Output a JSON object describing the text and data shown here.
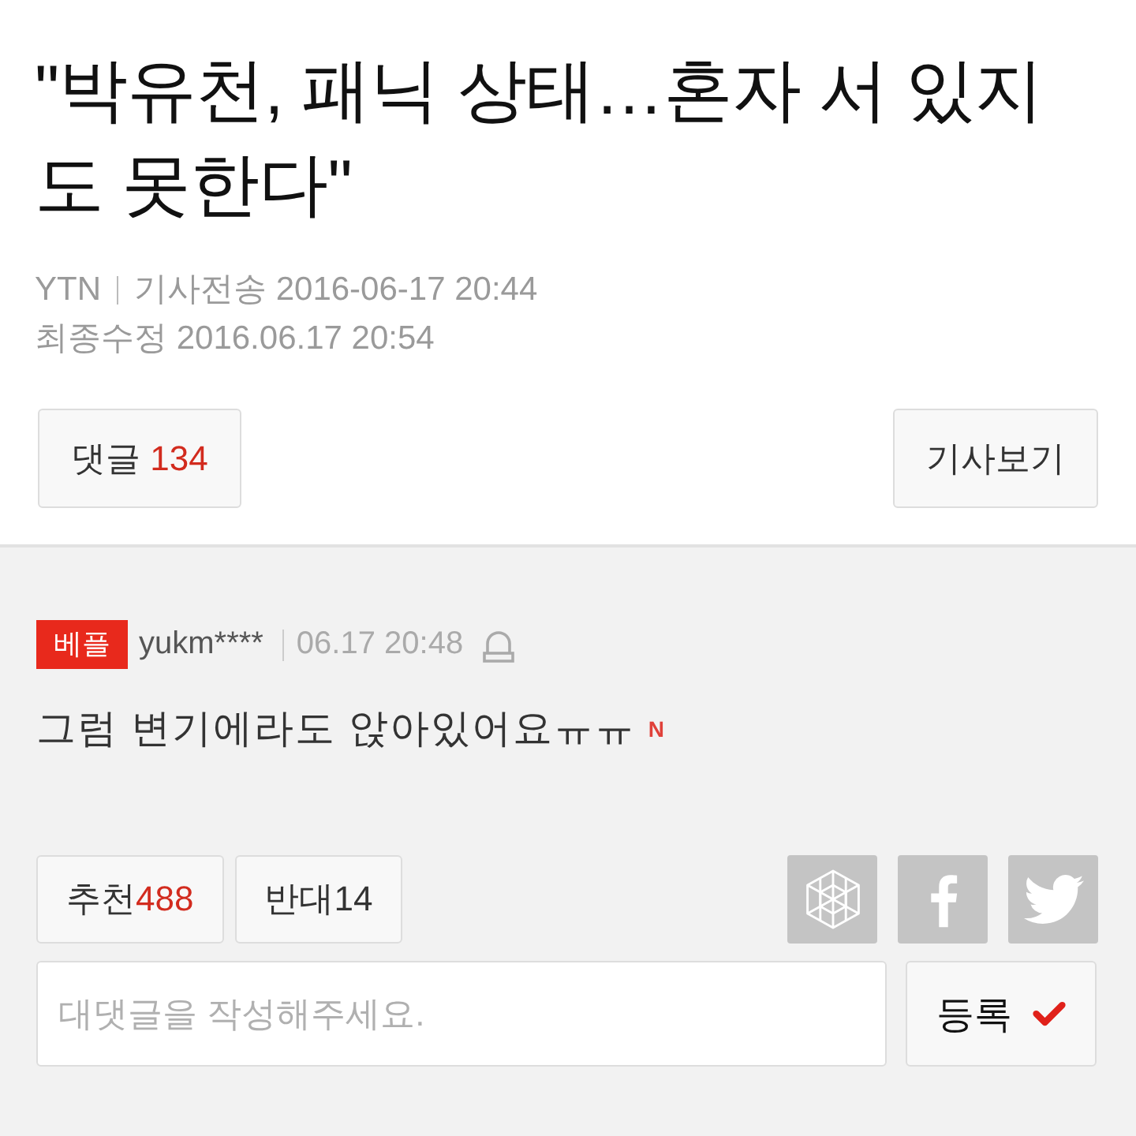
{
  "article": {
    "title_lines": [
      "\"박유천, 패닉 상태…혼자 서 있지",
      "도 못한다\""
    ],
    "meta": {
      "source": "YTN",
      "sent": "기사전송 2016-06-17 20:44",
      "modified": "최종수정 2016.06.17 20:54"
    },
    "comments_button": {
      "label": "댓글",
      "count": "134"
    },
    "article_button": {
      "label": "기사보기"
    }
  },
  "comment": {
    "badge": "베플",
    "author": "yukm****",
    "time": "06.17 20:48",
    "text": "그럼 변기에라도 앉아있어요ㅠㅠ",
    "new_mark": "N",
    "likes": {
      "label": "추천",
      "count": "488"
    },
    "dislikes": {
      "label": "반대",
      "count": "14"
    }
  },
  "share_buttons": [
    {
      "kind": "pattern"
    },
    {
      "kind": "facebook"
    },
    {
      "kind": "twitter"
    }
  ],
  "reply": {
    "placeholder": "대댓글을 작성해주세요."
  },
  "submit_button": {
    "label": "등록"
  }
}
